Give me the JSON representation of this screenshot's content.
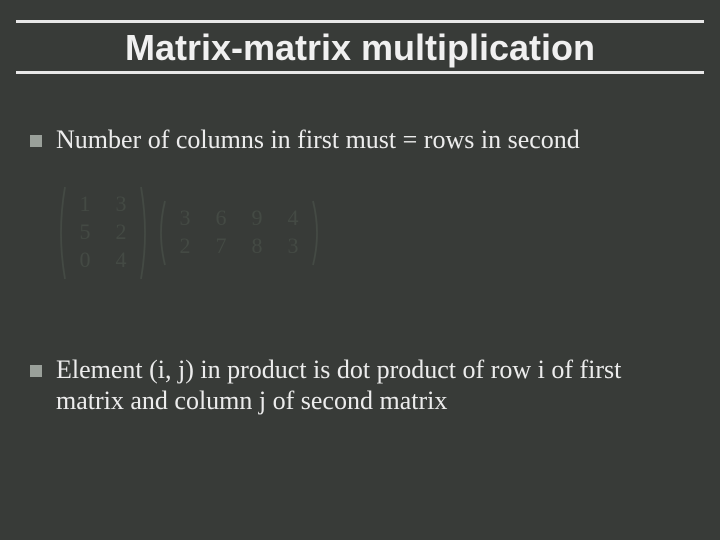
{
  "title": "Matrix-matrix multiplication",
  "bullets": [
    "Number of columns in first must  = rows in second",
    "Element (i, j) in product is dot product of row i of first matrix and column j of second matrix"
  ],
  "matrix_a": {
    "rows": 3,
    "cols": 2,
    "values": [
      1,
      3,
      5,
      2,
      0,
      4
    ]
  },
  "matrix_b": {
    "rows": 2,
    "cols": 4,
    "values": [
      3,
      6,
      9,
      4,
      2,
      7,
      8,
      3
    ]
  }
}
